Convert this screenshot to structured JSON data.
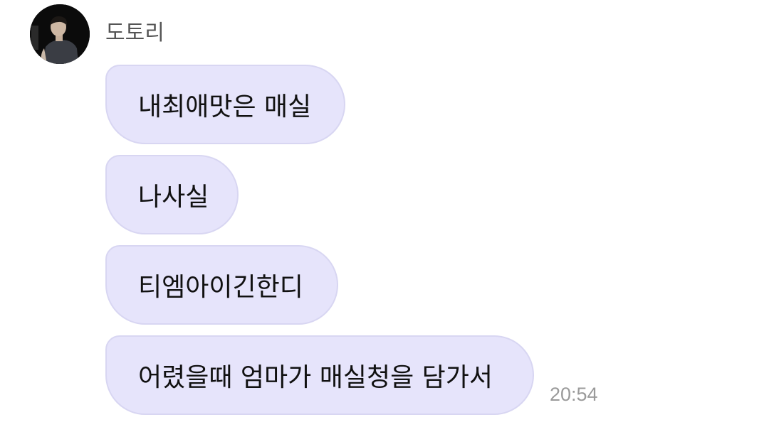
{
  "sender": {
    "name": "도토리",
    "avatar_icon": "profile-photo-icon"
  },
  "messages": [
    {
      "text": "내최애맛은 매실"
    },
    {
      "text": "나사실"
    },
    {
      "text": "티엠아이긴한디"
    },
    {
      "text": "어렸을때 엄마가 매실청을 담가서"
    }
  ],
  "timestamp": "20:54",
  "colors": {
    "bubble_background": "#e6e4fb",
    "bubble_border": "#d8d6f2",
    "name_text": "#555555",
    "timestamp_text": "#9a9a9a"
  }
}
